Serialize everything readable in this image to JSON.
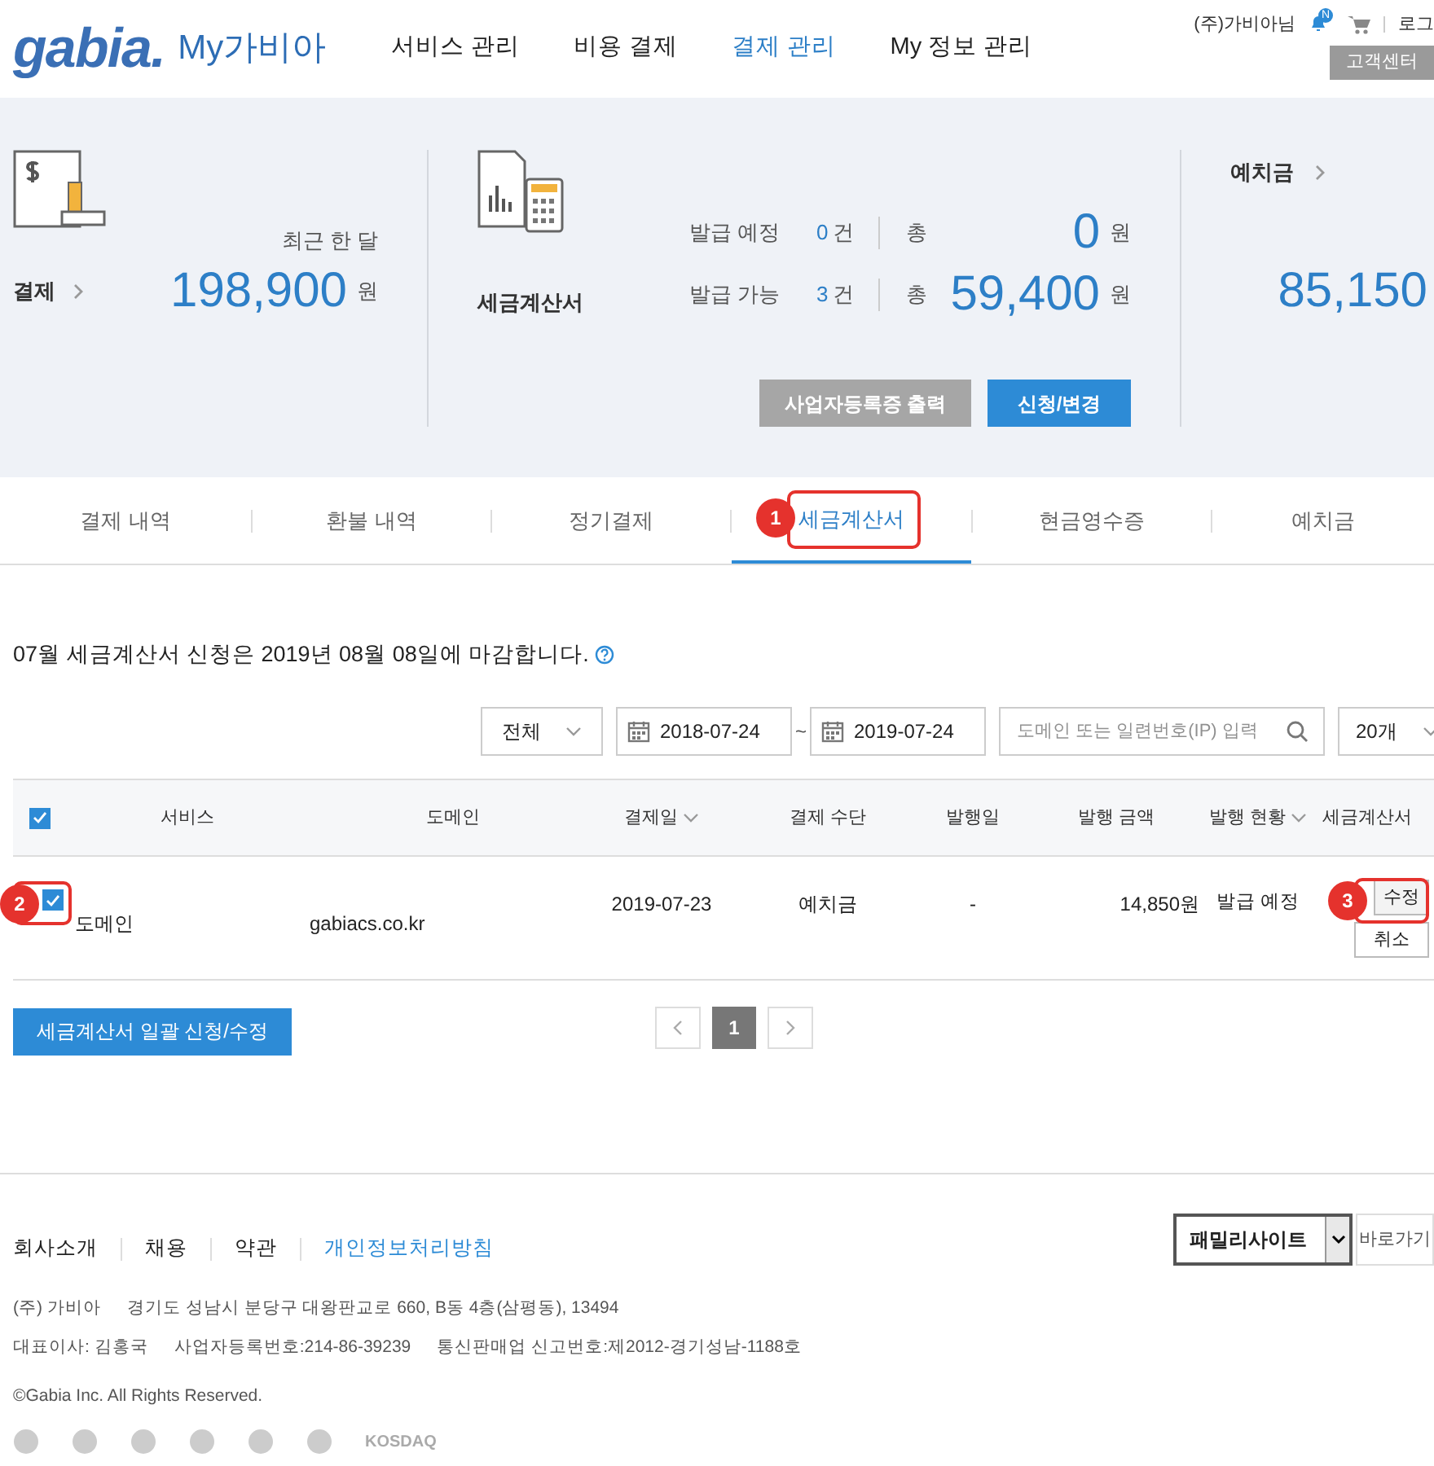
{
  "header": {
    "logo": "gabia.",
    "product": "My가비아",
    "nav": [
      {
        "label": "서비스 관리",
        "selected": false
      },
      {
        "label": "비용 결제",
        "selected": false
      },
      {
        "label": "결제 관리",
        "selected": true
      },
      {
        "label": "My 정보 관리",
        "selected": false
      }
    ],
    "user": "(주)가비아님",
    "notification_badge": "N",
    "logout": "로그",
    "support": "고객센터"
  },
  "summary": {
    "payment": {
      "period": "최근 한 달",
      "label": "결제",
      "amount": "198,900",
      "unit": "원"
    },
    "tax_invoice": {
      "label": "세금계산서",
      "rows": [
        {
          "label": "발급 예정",
          "count": "0",
          "count_unit": "건",
          "total_label": "총",
          "amount": "0",
          "unit": "원"
        },
        {
          "label": "발급 가능",
          "count": "3",
          "count_unit": "건",
          "total_label": "총",
          "amount": "59,400",
          "unit": "원"
        }
      ],
      "buttons": [
        {
          "label": "사업자등록증 출력",
          "kind": "secondary"
        },
        {
          "label": "신청/변경",
          "kind": "primary"
        }
      ]
    },
    "deposit": {
      "label": "예치금",
      "amount": "85,150"
    }
  },
  "tabs": [
    {
      "label": "결제 내역",
      "selected": false
    },
    {
      "label": "환불 내역",
      "selected": false
    },
    {
      "label": "정기결제",
      "selected": false
    },
    {
      "label": "세금계산서",
      "selected": true
    },
    {
      "label": "현금영수증",
      "selected": false
    },
    {
      "label": "예치금",
      "selected": false
    }
  ],
  "notice": "07월 세금계산서 신청은 2019년 08월 08일에 마감합니다.",
  "filters": {
    "type": "전체",
    "date_from": "2018-07-24",
    "separator": "~",
    "date_to": "2019-07-24",
    "search_placeholder": "도메인 또는 일련번호(IP) 입력",
    "page_size": "20개"
  },
  "table": {
    "all_checked": true,
    "columns": [
      {
        "label": "서비스",
        "sortable": false
      },
      {
        "label": "도메인",
        "sortable": false
      },
      {
        "label": "결제일",
        "sortable": true
      },
      {
        "label": "결제 수단",
        "sortable": false
      },
      {
        "label": "발행일",
        "sortable": false
      },
      {
        "label": "발행 금액",
        "sortable": false
      },
      {
        "label": "발행 현황",
        "sortable": true
      },
      {
        "label": "세금계산서",
        "sortable": false
      }
    ],
    "rows": [
      {
        "checked": true,
        "service": "도메인",
        "domain": "gabiacs.co.kr",
        "paid_on": "2019-07-23",
        "method": "예치금",
        "issued_on": "-",
        "amount": "14,850원",
        "status": "발급 예정",
        "actions": [
          "수정",
          "취소"
        ]
      }
    ]
  },
  "bulk_button": "세금계산서 일괄 신청/수정",
  "pagination": {
    "pages": [
      {
        "label": "1",
        "selected": true
      }
    ]
  },
  "annotations": [
    {
      "number": "1"
    },
    {
      "number": "2"
    },
    {
      "number": "3"
    }
  ],
  "footer": {
    "links": [
      {
        "label": "회사소개",
        "highlight": false
      },
      {
        "label": "채용",
        "highlight": false
      },
      {
        "label": "약관",
        "highlight": false
      },
      {
        "label": "개인정보처리방침",
        "highlight": true
      }
    ],
    "family_site": "패밀리사이트",
    "go": "바로가기",
    "lines": [
      [
        "(주) 가비아",
        "경기도 성남시 분당구 대왕판교로 660, B동 4층(삼평동), 13494"
      ],
      [
        "대표이사: 김홍국",
        "사업자등록번호:214-86-39239",
        "통신판매업 신고번호:제2012-경기성남-1188호"
      ]
    ],
    "copyright": "©Gabia Inc. All Rights Reserved.",
    "cert_text": "KOSDAQ"
  }
}
